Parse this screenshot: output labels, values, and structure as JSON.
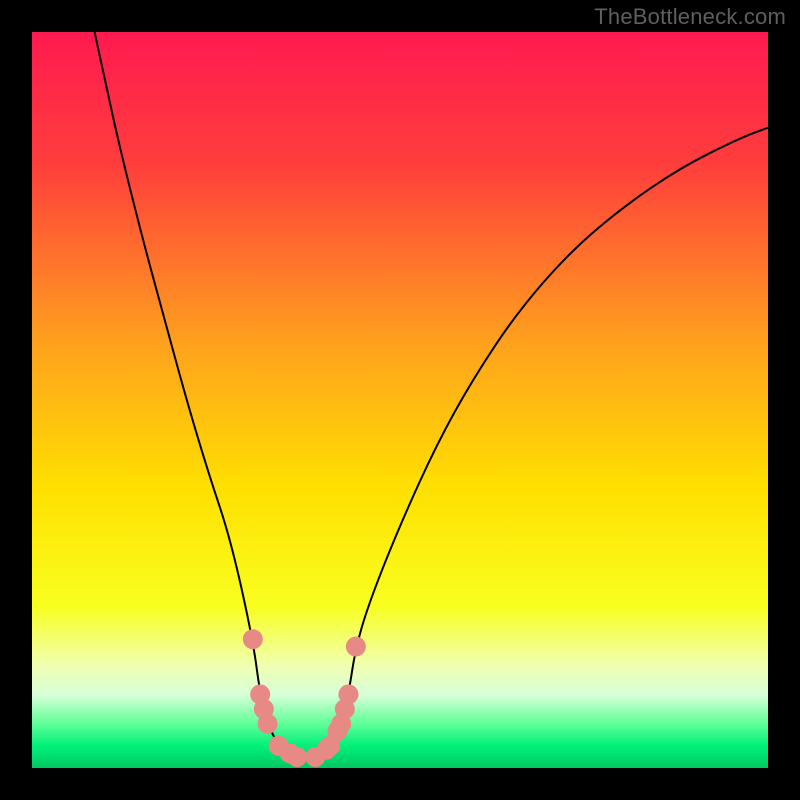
{
  "watermark": "TheBottleneck.com",
  "chart_data": {
    "type": "line",
    "title": "",
    "xlabel": "",
    "ylabel": "",
    "xlim": [
      0,
      100
    ],
    "ylim": [
      0,
      100
    ],
    "grid": false,
    "legend": false,
    "gradient_stops": [
      {
        "offset": 0.0,
        "color": "#ff1a50"
      },
      {
        "offset": 0.18,
        "color": "#ff3e3c"
      },
      {
        "offset": 0.42,
        "color": "#ffa01e"
      },
      {
        "offset": 0.62,
        "color": "#ffe000"
      },
      {
        "offset": 0.78,
        "color": "#f8ff20"
      },
      {
        "offset": 0.86,
        "color": "#f0ffb0"
      },
      {
        "offset": 0.9,
        "color": "#d8ffd8"
      },
      {
        "offset": 0.94,
        "color": "#60ff98"
      },
      {
        "offset": 0.97,
        "color": "#00f07a"
      },
      {
        "offset": 1.0,
        "color": "#00c860"
      }
    ],
    "series": [
      {
        "name": "bottleneck-curve",
        "color": "#000000",
        "stroke_width": 2,
        "points": [
          {
            "x": 8.5,
            "y": 100.0
          },
          {
            "x": 10.0,
            "y": 93.0
          },
          {
            "x": 12.0,
            "y": 84.0
          },
          {
            "x": 15.0,
            "y": 72.0
          },
          {
            "x": 18.0,
            "y": 61.0
          },
          {
            "x": 21.0,
            "y": 50.0
          },
          {
            "x": 24.0,
            "y": 40.0
          },
          {
            "x": 27.0,
            "y": 31.0
          },
          {
            "x": 30.0,
            "y": 17.5
          },
          {
            "x": 31.0,
            "y": 10.0
          },
          {
            "x": 32.0,
            "y": 6.0
          },
          {
            "x": 33.5,
            "y": 3.0
          },
          {
            "x": 36.0,
            "y": 1.5
          },
          {
            "x": 38.5,
            "y": 1.5
          },
          {
            "x": 40.5,
            "y": 3.0
          },
          {
            "x": 42.0,
            "y": 6.0
          },
          {
            "x": 43.0,
            "y": 10.0
          },
          {
            "x": 44.0,
            "y": 16.5
          },
          {
            "x": 46.0,
            "y": 23.0
          },
          {
            "x": 50.0,
            "y": 33.0
          },
          {
            "x": 55.0,
            "y": 44.0
          },
          {
            "x": 60.0,
            "y": 53.0
          },
          {
            "x": 66.0,
            "y": 62.0
          },
          {
            "x": 73.0,
            "y": 70.0
          },
          {
            "x": 80.0,
            "y": 76.0
          },
          {
            "x": 88.0,
            "y": 81.5
          },
          {
            "x": 96.0,
            "y": 85.5
          },
          {
            "x": 100.0,
            "y": 87.0
          }
        ]
      }
    ],
    "markers": {
      "name": "highlight-dots",
      "color": "#e78a86",
      "radius": 10,
      "points": [
        {
          "x": 30.0,
          "y": 17.5
        },
        {
          "x": 31.0,
          "y": 10.0
        },
        {
          "x": 31.5,
          "y": 8.0
        },
        {
          "x": 32.0,
          "y": 6.0
        },
        {
          "x": 33.5,
          "y": 3.0
        },
        {
          "x": 35.0,
          "y": 2.0
        },
        {
          "x": 36.0,
          "y": 1.5
        },
        {
          "x": 38.5,
          "y": 1.5
        },
        {
          "x": 40.0,
          "y": 2.5
        },
        {
          "x": 40.5,
          "y": 3.0
        },
        {
          "x": 41.5,
          "y": 5.0
        },
        {
          "x": 42.0,
          "y": 6.0
        },
        {
          "x": 42.5,
          "y": 8.0
        },
        {
          "x": 43.0,
          "y": 10.0
        },
        {
          "x": 44.0,
          "y": 16.5
        }
      ]
    }
  }
}
